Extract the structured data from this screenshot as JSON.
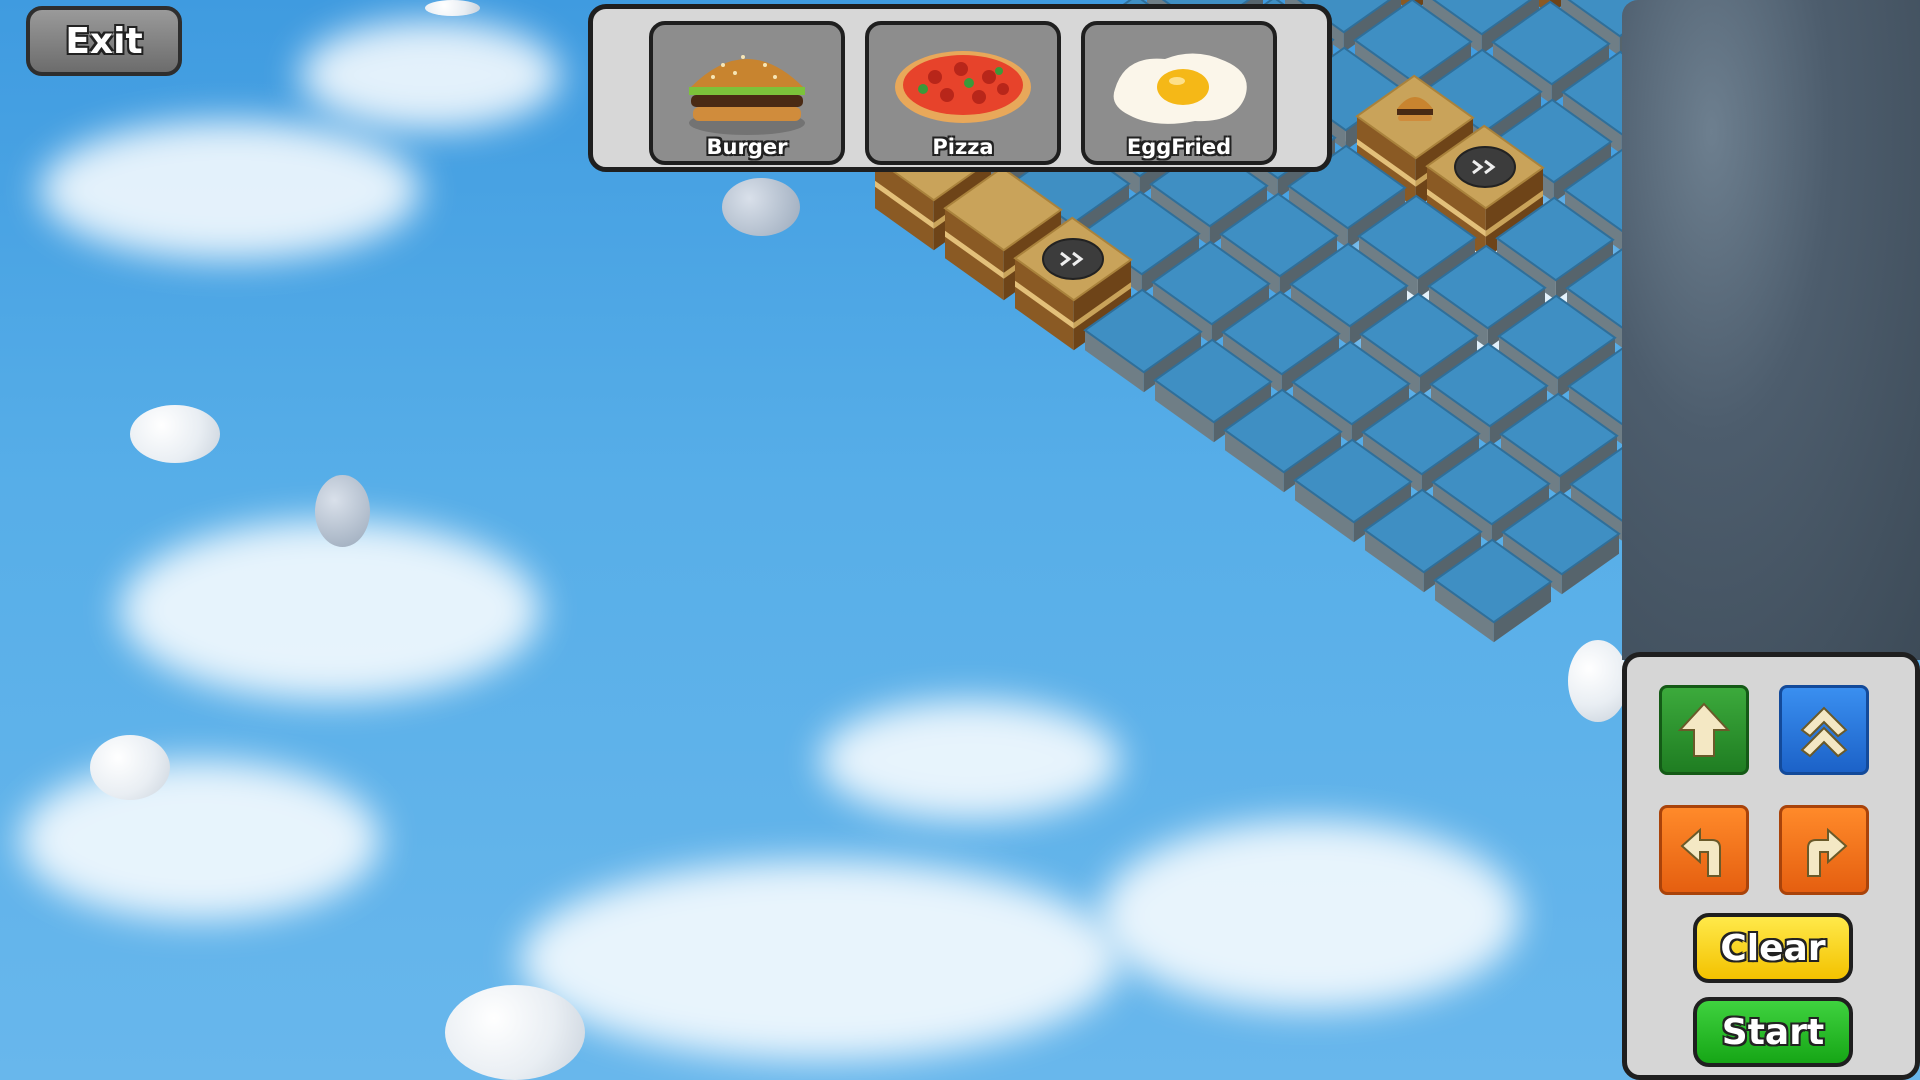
{
  "exit_label": "Exit",
  "collection": [
    {
      "name": "Burger",
      "icon": "burger-icon"
    },
    {
      "name": "Pizza",
      "icon": "pizza-icon"
    },
    {
      "name": "EggFried",
      "icon": "fried-egg-icon"
    }
  ],
  "controls": {
    "forward_icon": "arrow-up-icon",
    "jump_icon": "double-chevron-up-icon",
    "turn_left_icon": "turn-left-icon",
    "turn_right_icon": "turn-right-icon",
    "clear_label": "Clear",
    "start_label": "Start"
  },
  "colors": {
    "water_tile": "#3f8fc3",
    "path_tile": "#c9a35a",
    "forward_button": "#2e9a30",
    "jump_button": "#2874dd",
    "turn_buttons": "#f07420",
    "clear_button": "#f8d51a",
    "start_button": "#27bb27"
  }
}
